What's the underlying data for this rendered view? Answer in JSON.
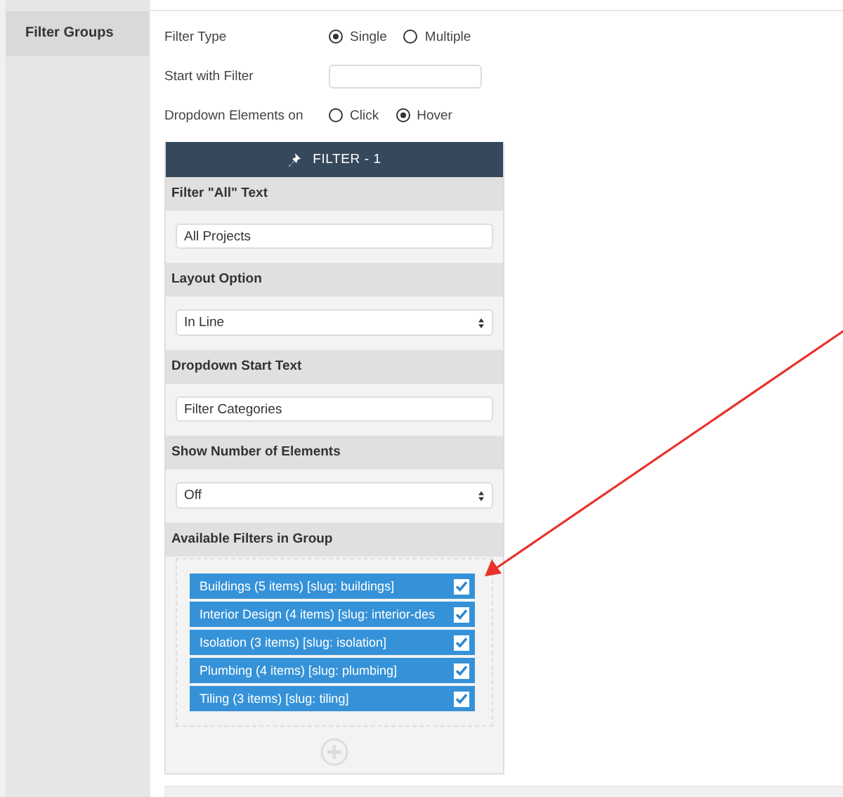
{
  "sidebar": {
    "items": [
      {
        "label": "Filter Groups",
        "selected": true
      }
    ]
  },
  "settings": [
    {
      "kind": "radio",
      "label": "Filter Type",
      "options": [
        {
          "label": "Single",
          "selected": true
        },
        {
          "label": "Multiple",
          "selected": false
        }
      ]
    },
    {
      "kind": "text",
      "label": "Start with Filter"
    },
    {
      "kind": "radio",
      "label": "Dropdown Elements on",
      "options": [
        {
          "label": "Click",
          "selected": false
        },
        {
          "label": "Hover",
          "selected": true
        }
      ]
    }
  ],
  "filter_panel": {
    "title": "FILTER - 1",
    "sections": [
      {
        "kind": "text",
        "label": "Filter \"All\" Text",
        "value": "All Projects"
      },
      {
        "kind": "select",
        "label": "Layout Option",
        "value": "In Line"
      },
      {
        "kind": "text",
        "label": "Dropdown Start Text",
        "value": "Filter Categories"
      },
      {
        "kind": "select",
        "label": "Show Number of Elements",
        "value": "Off"
      },
      {
        "kind": "checklist",
        "label": "Available Filters in Group",
        "items": [
          {
            "label": "Buildings (5 items) [slug: buildings]",
            "checked": true
          },
          {
            "label": "Interior Design (4 items) [slug: interior-des",
            "checked": true
          },
          {
            "label": "Isolation (3 items) [slug: isolation]",
            "checked": true
          },
          {
            "label": "Plumbing (4 items) [slug: plumbing]",
            "checked": true
          },
          {
            "label": "Tiling (3 items) [slug: tiling]",
            "checked": true
          }
        ]
      }
    ]
  }
}
